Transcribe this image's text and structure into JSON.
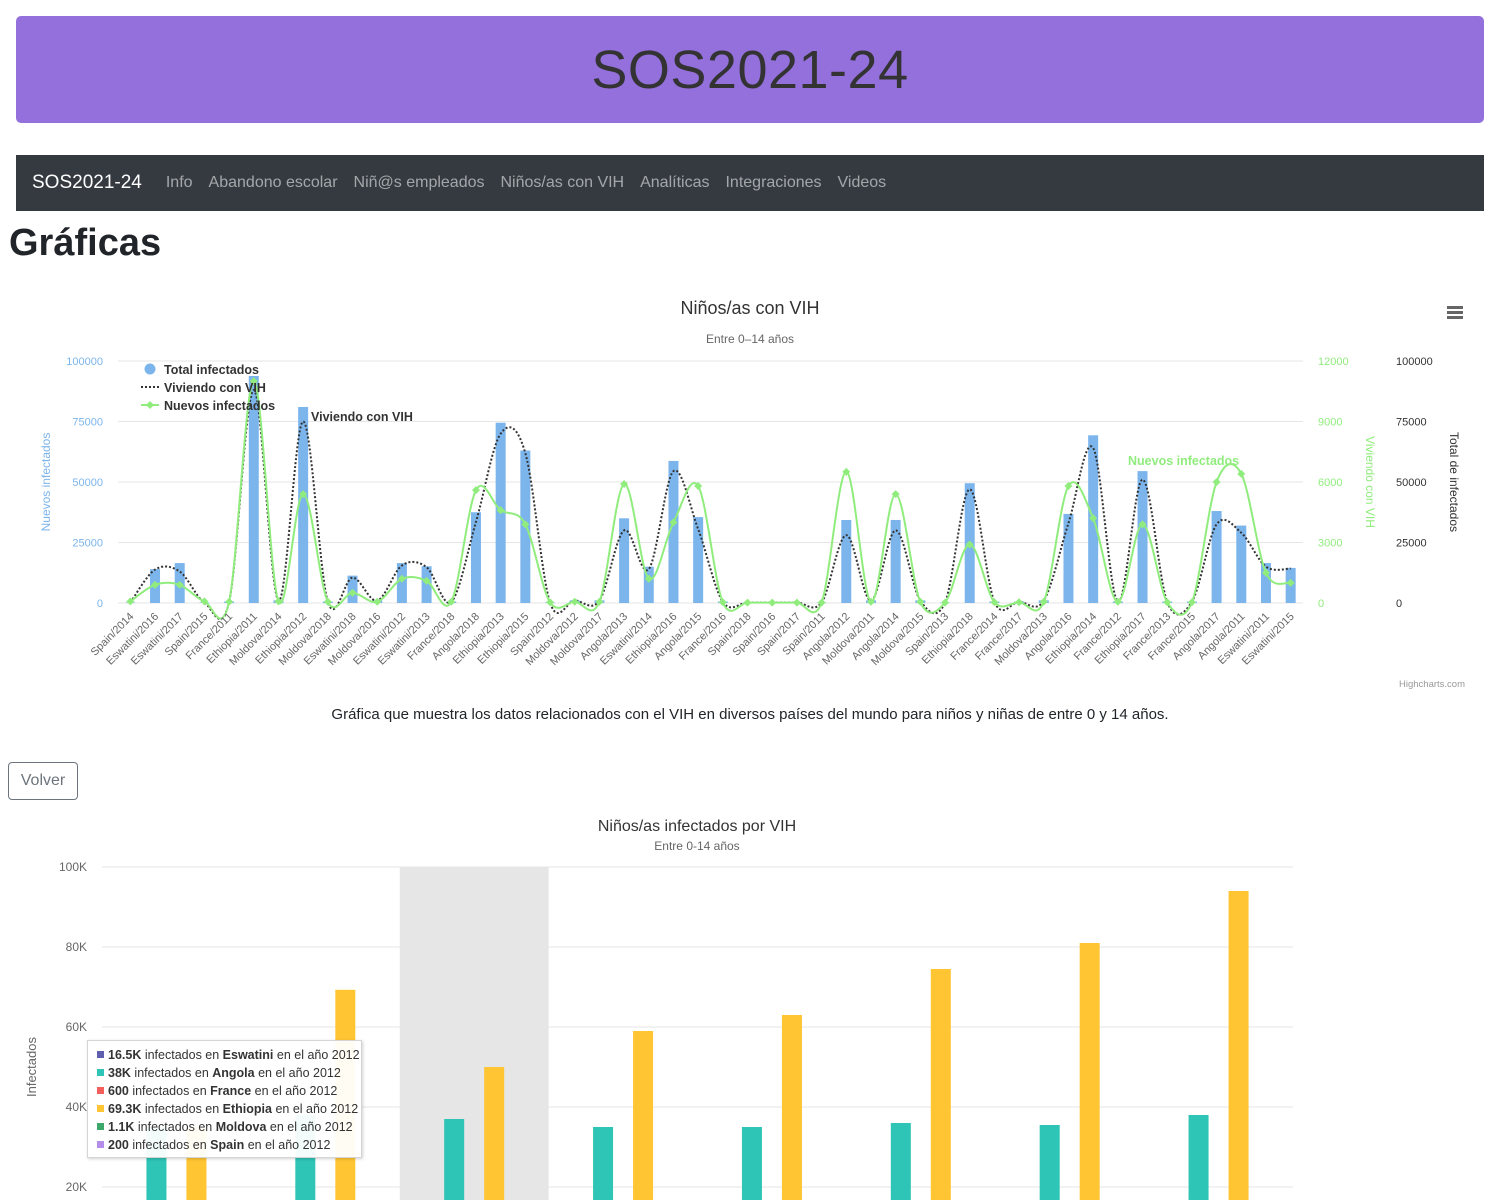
{
  "banner": {
    "title": "SOS2021-24",
    "color": "#9370db"
  },
  "navbar": {
    "brand": "SOS2021-24",
    "items": [
      "Info",
      "Abandono escolar",
      "Niñ@s empleados",
      "Niños/as con VIH",
      "Analíticas",
      "Integraciones",
      "Videos"
    ]
  },
  "page": {
    "title": "Gráficas",
    "caption": "Gráfica que muestra los datos relacionados con el VIH en diversos países del mundo para niños y niñas de entre 0 y 14 años.",
    "back_button": "Volver"
  },
  "chart_data": [
    {
      "type": "bar",
      "title": "Niños/as con VIH",
      "subtitle": "Entre 0–14 años",
      "credits": "Highcharts.com",
      "colors": {
        "bars": "#7cb5ec",
        "living": "#333333",
        "new": "#90ed7d"
      },
      "categories": [
        "Spain/2014",
        "Eswatini/2016",
        "Eswatini/2017",
        "Spain/2015",
        "France/2011",
        "Ethiopia/2011",
        "Moldova/2014",
        "Ethiopia/2012",
        "Moldova/2018",
        "Eswatini/2018",
        "Moldova/2016",
        "Eswatini/2012",
        "Eswatini/2013",
        "France/2018",
        "Angola/2018",
        "Ethiopia/2013",
        "Ethiopia/2015",
        "Spain/2012",
        "Moldova/2012",
        "Moldova/2017",
        "Angola/2013",
        "Eswatini/2014",
        "Ethiopia/2016",
        "Angola/2015",
        "France/2016",
        "Spain/2018",
        "Spain/2016",
        "Spain/2017",
        "Spain/2011",
        "Angola/2012",
        "Moldova/2011",
        "Angola/2014",
        "Moldova/2015",
        "Spain/2013",
        "Ethiopia/2018",
        "France/2014",
        "France/2017",
        "Moldova/2013",
        "Angola/2016",
        "Ethiopia/2014",
        "France/2012",
        "Ethiopia/2017",
        "France/2013",
        "France/2015",
        "Angola/2017",
        "Angola/2011",
        "Eswatini/2011",
        "Eswatini/2015"
      ],
      "axes": {
        "y_left": {
          "label": "Nuevos infectados",
          "ticks": [
            "100000",
            "75000",
            "50000",
            "25000",
            "0"
          ],
          "max": 100000
        },
        "y_right1": {
          "label": "Viviendo con VIH",
          "ticks": [
            "12000",
            "9000",
            "6000",
            "3000",
            "0"
          ],
          "max": 12000
        },
        "y_right2": {
          "label": "Total de infectados",
          "ticks": [
            "100000",
            "75000",
            "50000",
            "25000",
            "0"
          ],
          "max": 100000
        }
      },
      "legend": [
        "Total infectados",
        "Viviendo con VIH",
        "Nuevos infectados"
      ],
      "annotations": {
        "living": "Viviendo con VIH",
        "new": "Nuevos infectados"
      },
      "series": [
        {
          "name": "Total infectados",
          "axis": "y_left",
          "values": [
            200,
            14000,
            16500,
            200,
            600,
            93800,
            1100,
            81000,
            600,
            11300,
            1100,
            16500,
            15200,
            600,
            37500,
            74500,
            63000,
            200,
            1100,
            1100,
            35000,
            15000,
            58700,
            35500,
            600,
            200,
            200,
            200,
            200,
            34300,
            1100,
            34300,
            1100,
            200,
            49500,
            600,
            600,
            1100,
            36800,
            69300,
            600,
            54500,
            600,
            600,
            38000,
            32000,
            16500,
            14500
          ]
        },
        {
          "name": "Viviendo con VIH",
          "axis": "y_left",
          "values": [
            200,
            13800,
            13000,
            200,
            500,
            88000,
            1000,
            75000,
            500,
            10500,
            1000,
            15500,
            14800,
            500,
            33500,
            70000,
            62000,
            200,
            1000,
            1000,
            30000,
            14000,
            54500,
            30500,
            500,
            200,
            200,
            200,
            200,
            28000,
            1000,
            30000,
            1000,
            200,
            47000,
            500,
            500,
            1000,
            33000,
            64000,
            500,
            51000,
            500,
            500,
            32500,
            29000,
            15000,
            14200
          ]
        },
        {
          "name": "Nuevos infectados",
          "axis": "y_right1",
          "values": [
            80,
            900,
            900,
            80,
            60,
            11000,
            80,
            5400,
            60,
            500,
            60,
            1200,
            1100,
            60,
            5600,
            4600,
            3900,
            40,
            60,
            60,
            5900,
            1200,
            4000,
            5800,
            40,
            20,
            20,
            20,
            20,
            6500,
            60,
            5400,
            60,
            20,
            2900,
            40,
            40,
            60,
            5800,
            4200,
            60,
            3900,
            40,
            40,
            6000,
            6400,
            1500,
            1000
          ]
        }
      ]
    },
    {
      "type": "bar",
      "title": "Niños/as infectados por VIH",
      "subtitle": "Entre 0-14 años",
      "ylabel": "Infectados",
      "y_ticks": [
        "100K",
        "80K",
        "60K",
        "40K",
        "20K"
      ],
      "ylim": [
        0,
        100000
      ],
      "groups": 8,
      "highlighted_group": 2,
      "series": [
        {
          "name": "Angola",
          "color": "#2ec4b6",
          "values": [
            35000,
            38000,
            37000,
            35000,
            35000,
            36000,
            35500,
            38000
          ]
        },
        {
          "name": "Ethiopia",
          "color": "#ffc533",
          "values": [
            35000,
            69300,
            50000,
            59000,
            63000,
            74500,
            81000,
            94000
          ]
        }
      ],
      "tooltip": [
        {
          "value": "16.5K",
          "country": "Eswatini",
          "year": "2012",
          "color": "#5f5fb0"
        },
        {
          "value": "38K",
          "country": "Angola",
          "year": "2012",
          "color": "#2ec4b6"
        },
        {
          "value": "600",
          "country": "France",
          "year": "2012",
          "color": "#f25f5c"
        },
        {
          "value": "69.3K",
          "country": "Ethiopia",
          "year": "2012",
          "color": "#ffc533"
        },
        {
          "value": "1.1K",
          "country": "Moldova",
          "year": "2012",
          "color": "#3aa96a"
        },
        {
          "value": "200",
          "country": "Spain",
          "year": "2012",
          "color": "#b48ee8"
        }
      ],
      "tooltip_text": {
        "mid": "infectados en",
        "end": "en el año"
      }
    }
  ]
}
